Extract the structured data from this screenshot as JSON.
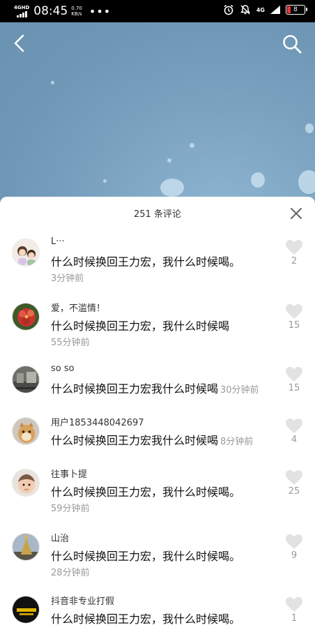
{
  "status_bar": {
    "network": "4GHD",
    "time": "08:45",
    "speed_value": "0.70",
    "speed_unit": "KB/s",
    "more": "•••",
    "lte": "4G",
    "battery": "8",
    "battery_color": "#e8353b"
  },
  "header": {
    "back_icon": "chevron-left-icon",
    "search_icon": "search-icon"
  },
  "comments_panel": {
    "count_label": "251 条评论",
    "close_icon": "close-icon",
    "comments": [
      {
        "user": "L···",
        "text": "什么时候换回王力宏，我什么时候喝。",
        "time": "3分钟前",
        "likes": "2"
      },
      {
        "user": "爱，不滥情！",
        "text": "什么时候换回王力宏，我什么时候喝",
        "time": "55分钟前",
        "likes": "15"
      },
      {
        "user": "so so",
        "text": "什么时候换回王力宏我什么时候喝",
        "time": "30分钟前",
        "likes": "15"
      },
      {
        "user": "用户1853448042697",
        "text": "什么时候换回王力宏我什么时候喝",
        "time": "8分钟前",
        "likes": "4"
      },
      {
        "user": "往事卜提",
        "text": "什么时候换回王力宏，我什么时候喝。",
        "time": "59分钟前",
        "likes": "25"
      },
      {
        "user": "山治",
        "text": "什么时候换回王力宏，我什么时候喝。",
        "time": "28分钟前",
        "likes": "9"
      },
      {
        "user": "抖音非专业打假",
        "text": "什么时候换回王力宏，我什么时候喝。",
        "time": "",
        "likes": "1"
      }
    ]
  },
  "colors": {
    "like_heart": "#e2e2e2",
    "meta_text": "#9a9a9a"
  }
}
